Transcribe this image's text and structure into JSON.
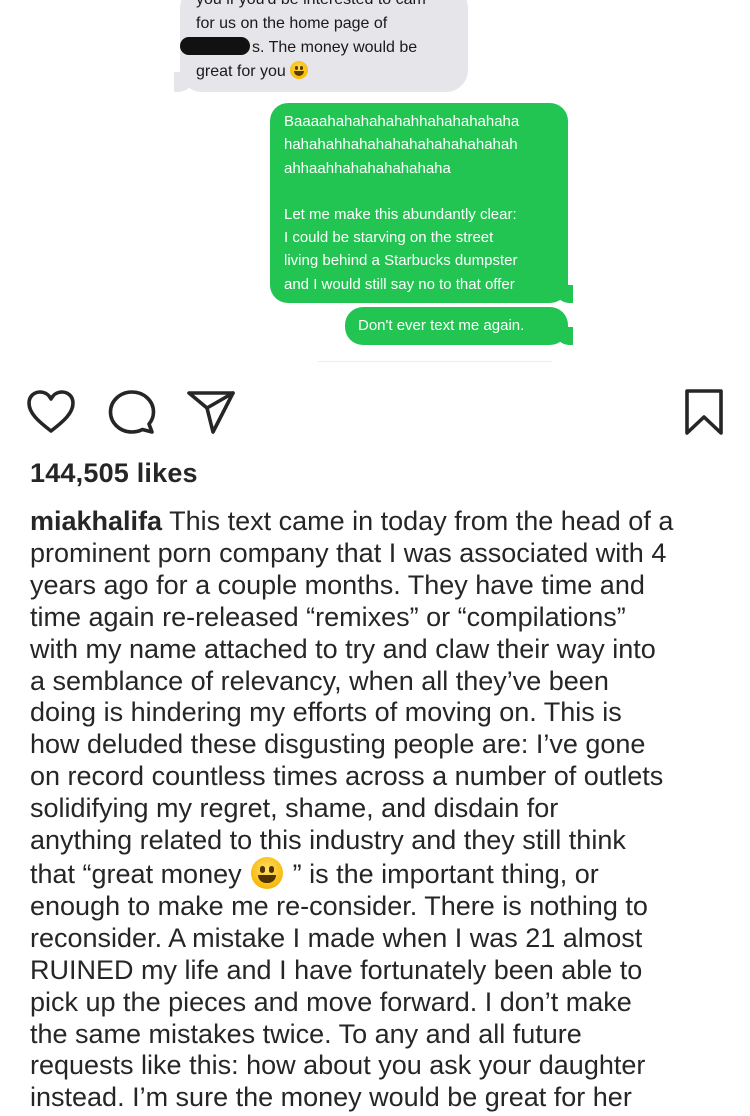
{
  "conversation": {
    "incoming": {
      "lines": [
        "you if you'd be interested to cam",
        "for us on the home page of",
        "s. The money would be",
        "great for you"
      ],
      "emoji": "grinning-face-emoji"
    },
    "outgoing": [
      {
        "lines": [
          "Baaaahahahahahahhahahahahaha",
          "hahahahhahahahahahahahahahah",
          "ahhaahhahahahahahaha",
          "",
          "Let me make this abundantly clear:",
          "I could be starving on the street",
          "living behind a Starbucks dumpster",
          "and I would still say no to that offer"
        ]
      },
      {
        "lines": [
          "Don't ever text me again."
        ]
      }
    ],
    "colors": {
      "incoming_bubble": "#e5e5ea",
      "outgoing_bubble": "#23c552"
    }
  },
  "actions": {
    "like_icon": "heart-outline-icon",
    "comment_icon": "comment-bubble-icon",
    "share_icon": "paper-plane-icon",
    "save_icon": "bookmark-icon"
  },
  "post": {
    "likes": "144,505 likes",
    "username": "miakhalifa",
    "caption_lines": [
      " This text came in today from the head of a",
      "prominent porn company that I was associated with 4",
      "years ago for a couple months. They have time and",
      "time again re-released “remixes” or “compilations”",
      "with my name attached to try and claw their way into",
      "a semblance of relevancy, when all they’ve been",
      "doing is hindering my efforts of moving on. This is",
      "how deluded these disgusting people are: I’ve gone",
      "on record countless times across a number of outlets",
      "solidifying my regret, shame, and disdain for",
      "anything related to this industry and they still think",
      "that “great money",
      " ” is the important thing, or",
      "enough to make me re-consider. There is nothing to",
      "reconsider. A mistake I made when I was 21 almost",
      "RUINED my life and I have fortunately been able to",
      "pick up the pieces and move forward. I don’t make",
      "the same mistakes twice. To any and all future",
      "requests like this: how about you ask your daughter",
      "instead. I’m sure the money would be great for her"
    ]
  }
}
